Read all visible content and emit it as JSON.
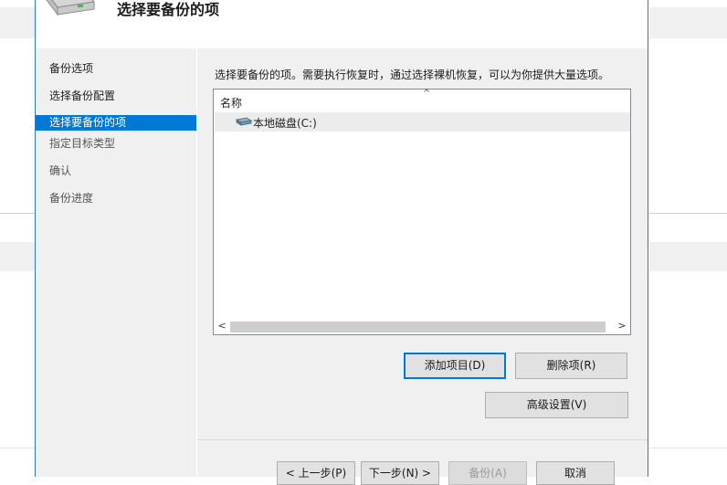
{
  "dialog": {
    "title": "选择要备份的项"
  },
  "nav": {
    "items": [
      {
        "label": "备份选项",
        "state": "done"
      },
      {
        "label": "选择备份配置",
        "state": "done"
      },
      {
        "label": "选择要备份的项",
        "state": "active"
      },
      {
        "label": "指定目标类型",
        "state": "future"
      },
      {
        "label": "确认",
        "state": "future"
      },
      {
        "label": "备份进度",
        "state": "future"
      }
    ]
  },
  "content": {
    "instruction": "选择要备份的项。需要执行恢复时，通过选择裸机恢复，可以为你提供大量选项。",
    "list": {
      "column_header": "名称",
      "sort_indicator": "^",
      "rows": [
        {
          "label": "本地磁盘(C:)",
          "icon": "hard-drive-icon"
        }
      ],
      "scroll_left": "<",
      "scroll_right": ">"
    },
    "buttons": {
      "add_items": "添加项目(D)",
      "remove_item": "删除项(R)",
      "advanced": "高级设置(V)"
    }
  },
  "footer": {
    "prev": "< 上一步(P)",
    "next": "下一步(N) >",
    "backup": "备份(A)",
    "cancel": "取消"
  },
  "colors": {
    "accent": "#0078d7",
    "border_blue": "#2b79c9",
    "panel_bg": "#f0f0f0"
  }
}
